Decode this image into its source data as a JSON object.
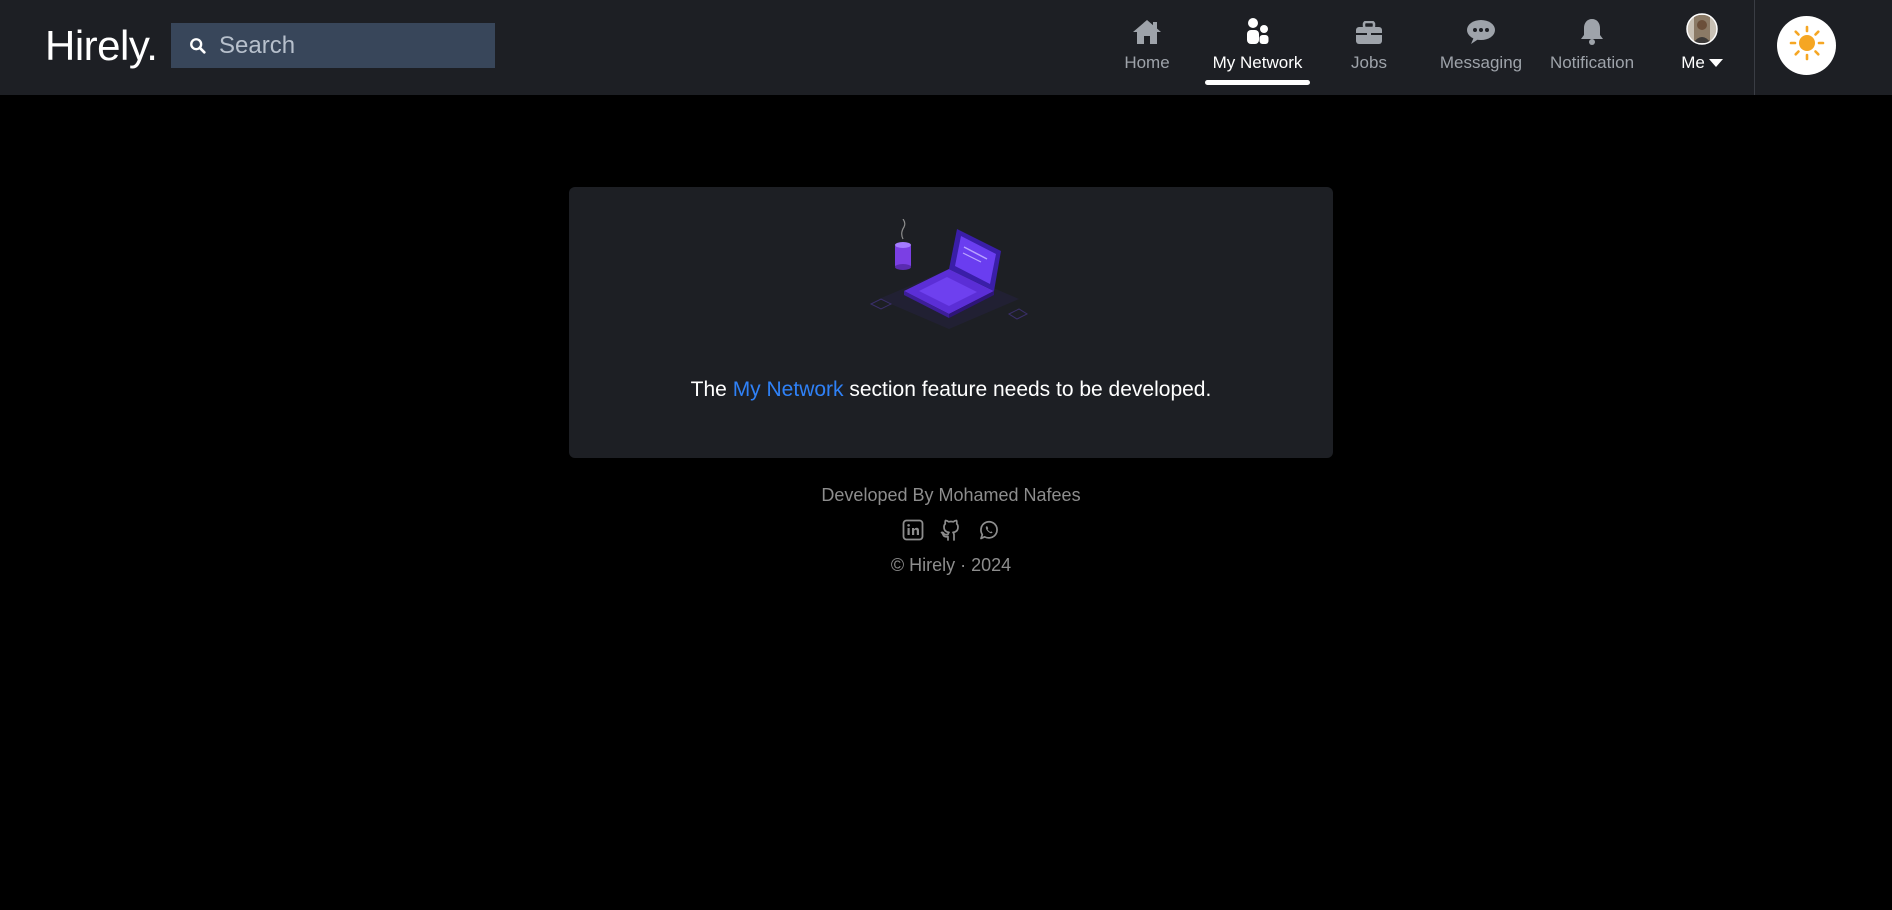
{
  "app": {
    "logo": "Hirely."
  },
  "search": {
    "placeholder": "Search"
  },
  "nav": {
    "items": [
      {
        "label": "Home",
        "icon": "home-icon"
      },
      {
        "label": "My Network",
        "icon": "network-icon",
        "active": true
      },
      {
        "label": "Jobs",
        "icon": "briefcase-icon"
      },
      {
        "label": "Messaging",
        "icon": "chat-icon"
      },
      {
        "label": "Notification",
        "icon": "bell-icon"
      },
      {
        "label": "Me",
        "icon": "avatar"
      }
    ],
    "theme_toggle_icon": "sun-icon"
  },
  "card": {
    "illustration": "laptop-coffee-illustration",
    "message_prefix": "The ",
    "message_highlight": "My Network",
    "message_suffix": " section feature needs to be developed."
  },
  "footer": {
    "credit": "Developed By Mohamed Nafees",
    "social_icons": [
      "linkedin-icon",
      "github-icon",
      "whatsapp-icon"
    ],
    "copyright": "© Hirely · 2024"
  },
  "colors": {
    "background": "#000000",
    "navbar": "#1d1f24",
    "search_bg": "#38465a",
    "highlight": "#2f81f7",
    "muted_text": "#8d8d8d",
    "sun": "#f5a623"
  }
}
